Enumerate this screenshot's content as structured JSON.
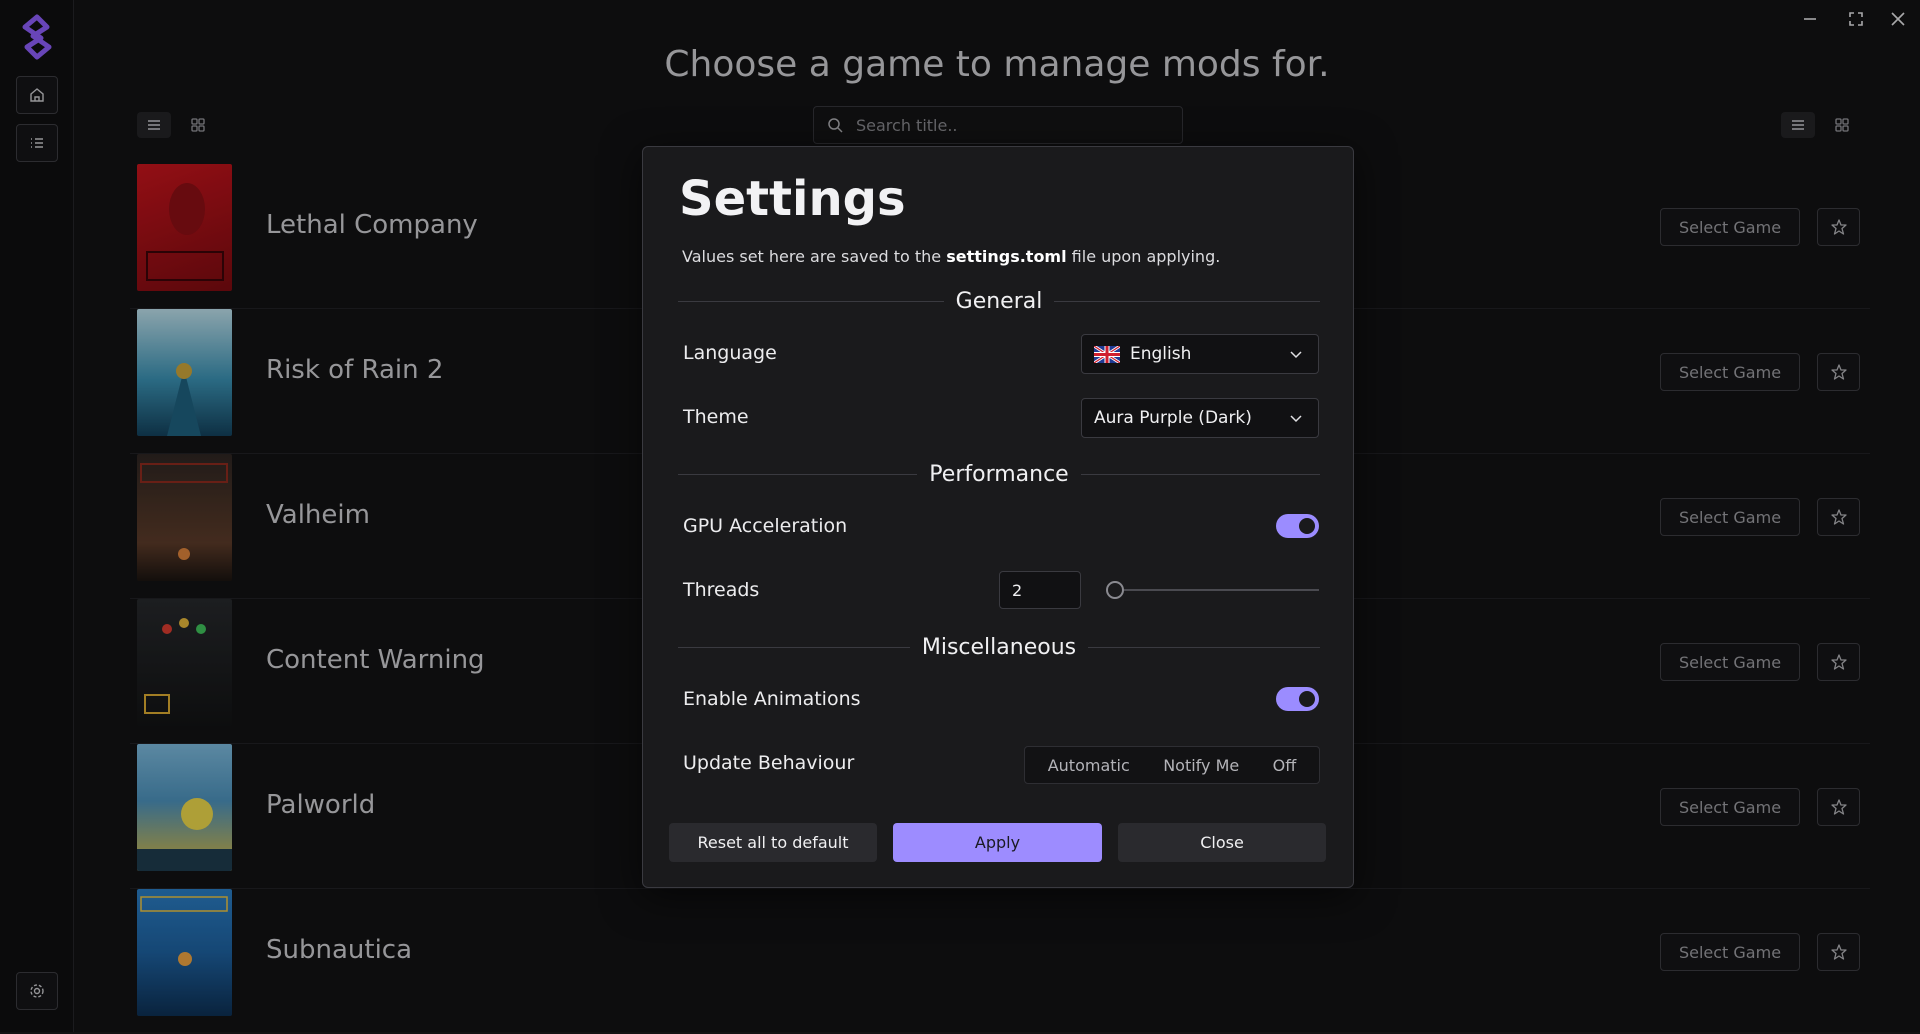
{
  "header": {
    "title": "Choose a game to manage mods for.",
    "search_placeholder": "Search title.."
  },
  "sidebar": {
    "logo": "app-logo",
    "items": [
      {
        "icon": "home-icon"
      },
      {
        "icon": "list-icon"
      },
      {
        "icon": "gear-icon"
      }
    ]
  },
  "window_controls": [
    "minimize",
    "maximize",
    "close"
  ],
  "games": [
    {
      "title": "Lethal Company",
      "select_label": "Select Game",
      "cover_color": "#b01a1f"
    },
    {
      "title": "Risk of Rain 2",
      "select_label": "Select Game",
      "cover_color": "#3a8fb0"
    },
    {
      "title": "Valheim",
      "select_label": "Select Game",
      "cover_color": "#3b2d24"
    },
    {
      "title": "Content Warning",
      "select_label": "Select Game",
      "cover_color": "#1d1f22"
    },
    {
      "title": "Palworld",
      "select_label": "Select Game",
      "cover_color": "#4b8fb8"
    },
    {
      "title": "Subnautica",
      "select_label": "Select Game",
      "cover_color": "#1d5f9c"
    }
  ],
  "settings": {
    "title": "Settings",
    "subtitle_pre": "Values set here are saved to the ",
    "subtitle_file": "settings.toml",
    "subtitle_post": " file upon applying.",
    "sections": {
      "general": "General",
      "performance": "Performance",
      "misc": "Miscellaneous"
    },
    "language_label": "Language",
    "language_value": "English",
    "theme_label": "Theme",
    "theme_value": "Aura Purple (Dark)",
    "gpu_label": "GPU Acceleration",
    "gpu_enabled": true,
    "threads_label": "Threads",
    "threads_value": "2",
    "animations_label": "Enable Animations",
    "animations_enabled": true,
    "update_label": "Update Behaviour",
    "update_options": [
      "Automatic",
      "Notify Me",
      "Off"
    ],
    "reset_label": "Reset all to default",
    "apply_label": "Apply",
    "close_label": "Close"
  },
  "colors": {
    "accent": "#9d8cff",
    "background": "#121213"
  }
}
